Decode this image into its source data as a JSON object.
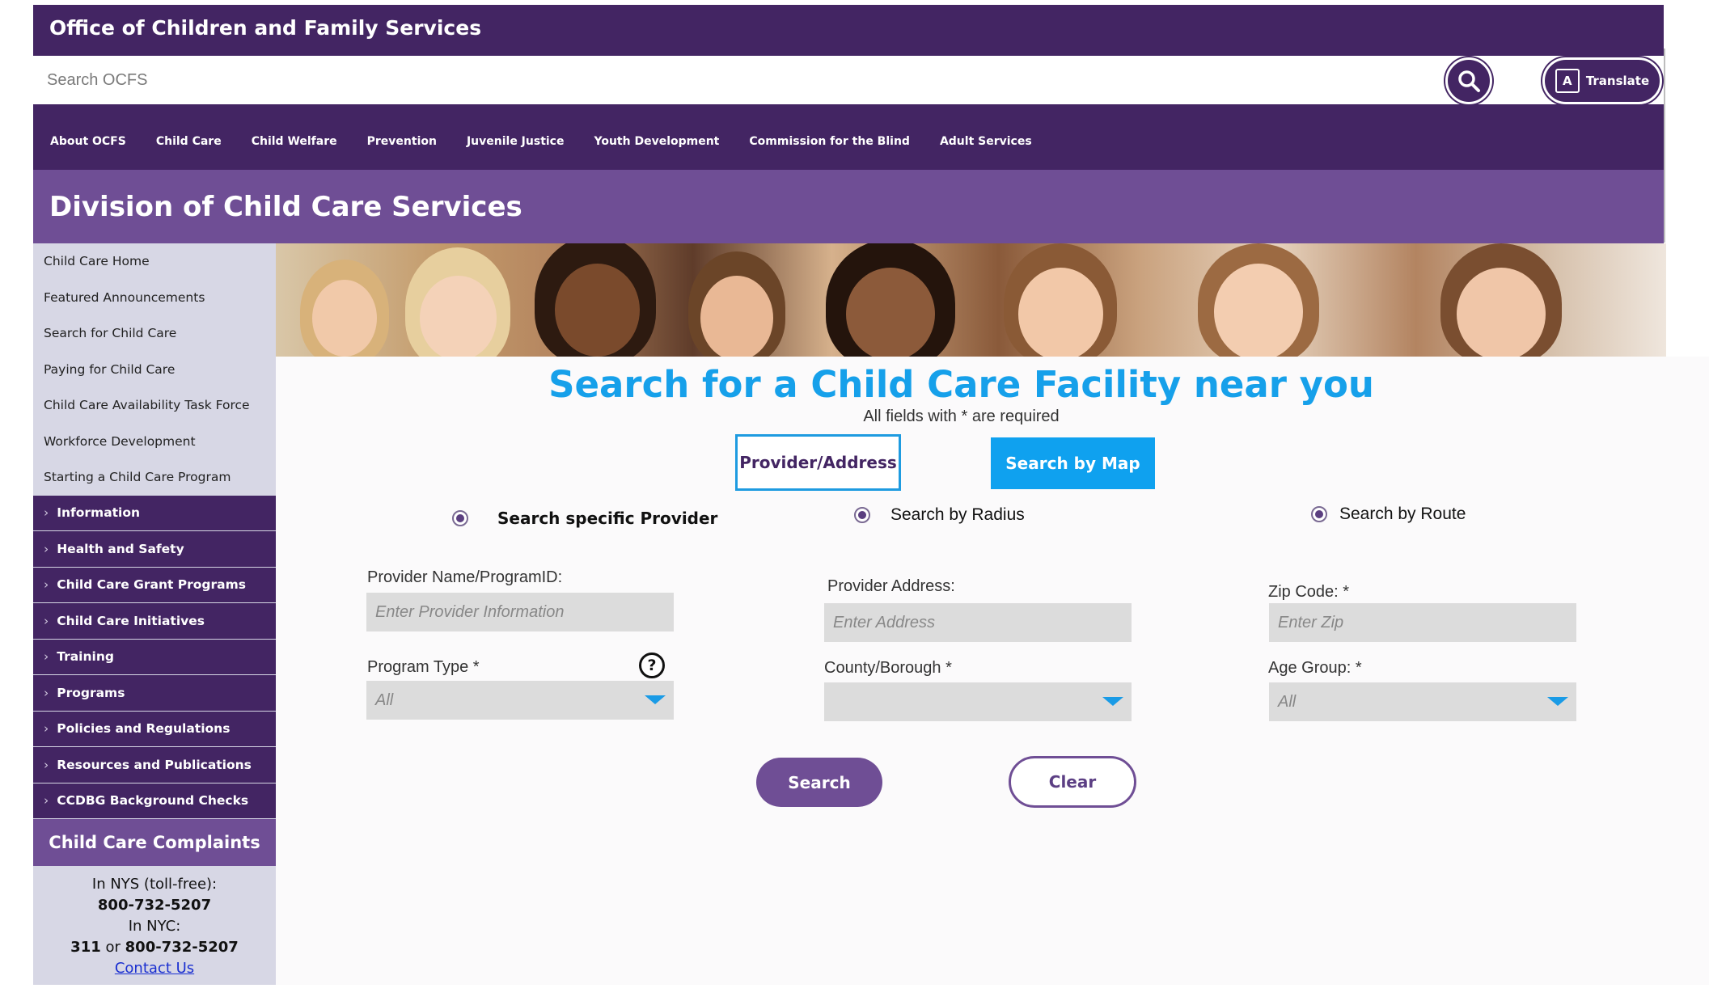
{
  "header": {
    "agency_name": "Office of Children and Family Services",
    "search_placeholder": "Search OCFS",
    "translate_label": "Translate",
    "brand_color": "#432563"
  },
  "nav": {
    "items": [
      "About OCFS",
      "Child Care",
      "Child Welfare",
      "Prevention",
      "Juvenile Justice",
      "Youth Development",
      "Commission for the Blind",
      "Adult Services"
    ]
  },
  "division": {
    "title": "Division of Child Care Services"
  },
  "sidebar": {
    "links": [
      "Child Care Home",
      "Featured Announcements",
      "Search for Child Care",
      "Paying for Child Care",
      "Child Care Availability Task Force",
      "Workforce Development",
      "Starting a Child Care Program"
    ],
    "sections": [
      "Information",
      "Health and Safety",
      "Child Care Grant Programs",
      "Child Care Initiatives",
      "Training",
      "Programs",
      "Policies and Regulations",
      "Resources and Publications",
      "CCDBG Background Checks"
    ],
    "complaints": {
      "title": "Child Care Complaints",
      "nys_label": "In NYS (toll-free):",
      "nys_phone": "800-732-5207",
      "nyc_label": "In NYC:",
      "nyc_311": "311",
      "nyc_or": "or",
      "nyc_phone": "800-732-5207",
      "contact_link": "Contact Us"
    }
  },
  "main": {
    "title": "Search for a Child Care Facility near you",
    "required_note": "All fields with * are required",
    "tabs": {
      "provider_address": "Provider/Address",
      "search_by_map": "Search by Map"
    },
    "radios": {
      "specific_provider": "Search specific Provider",
      "by_radius": "Search by Radius",
      "by_route": "Search by Route"
    },
    "fields": {
      "provider_name_label": "Provider Name/ProgramID:",
      "provider_name_placeholder": "Enter Provider Information",
      "provider_address_label": "Provider Address:",
      "provider_address_placeholder": "Enter Address",
      "zip_label": "Zip Code: *",
      "zip_placeholder": "Enter Zip",
      "program_type_label": "Program Type *",
      "program_type_value": "All",
      "county_label": "County/Borough *",
      "county_value": "",
      "age_group_label": "Age Group: *",
      "age_group_value": "All",
      "help_glyph": "?"
    },
    "buttons": {
      "search": "Search",
      "clear": "Clear"
    },
    "accent_color": "#16a0ea"
  }
}
